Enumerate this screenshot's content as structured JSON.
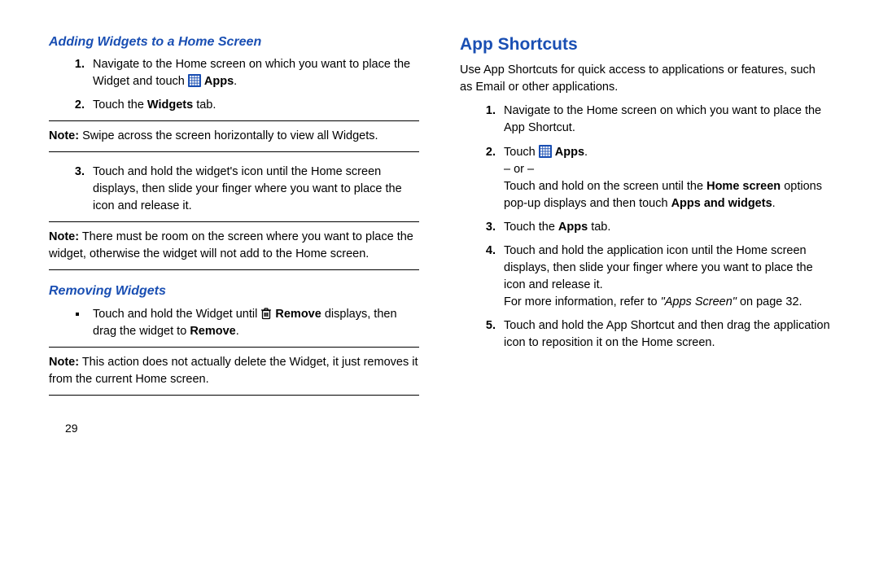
{
  "pageNumber": "29",
  "left": {
    "heading1": "Adding Widgets to a Home Screen",
    "step1_a": "Navigate to the Home screen on which you want to place the Widget and touch ",
    "step1_apps": "Apps",
    "step1_b": ".",
    "step2_a": "Touch the ",
    "step2_bold": "Widgets",
    "step2_b": " tab.",
    "note1_label": "Note:",
    "note1_text": " Swipe across the screen horizontally to view all Widgets.",
    "step3": "Touch and hold the widget's icon until the Home screen displays, then slide your finger where you want to place the icon and release it.",
    "note2_label": "Note:",
    "note2_text": " There must be room on the screen where you want to place the widget, otherwise the widget will not add to the Home screen.",
    "heading2": "Removing Widgets",
    "remove_a": "Touch and hold the Widget until ",
    "remove_bold1": "Remove",
    "remove_b": " displays, then drag the widget to ",
    "remove_bold2": "Remove",
    "remove_c": ".",
    "note3_label": "Note:",
    "note3_text": " This action does not actually delete the Widget, it just removes it from the current Home screen."
  },
  "right": {
    "heading": "App Shortcuts",
    "intro": "Use App Shortcuts for quick access to applications or features, such as Email or other applications.",
    "step1": "Navigate to the Home screen on which you want to place the App Shortcut.",
    "step2_a": "Touch ",
    "step2_apps": "Apps",
    "step2_b": ".",
    "step2_or": "– or –",
    "step2_c": "Touch and hold on the screen until the ",
    "step2_bold1": "Home screen",
    "step2_d": " options pop-up displays and then touch ",
    "step2_bold2": "Apps and widgets",
    "step2_e": ".",
    "step3_a": "Touch the ",
    "step3_bold": "Apps",
    "step3_b": " tab.",
    "step4_a": "Touch and hold the application icon until the Home screen displays, then slide your finger where you want to place the icon and release it.",
    "step4_b": "For more information, refer to ",
    "step4_ital": "\"Apps Screen\"",
    "step4_c": " on page 32.",
    "step5": "Touch and hold the App Shortcut and then drag the application icon to reposition it on the Home screen."
  }
}
